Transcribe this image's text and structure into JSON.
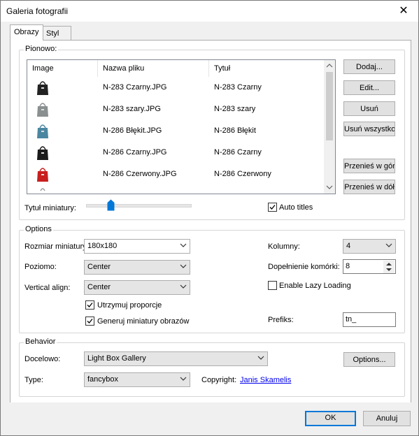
{
  "dialog": {
    "title": "Galeria fotografii",
    "close_symbol": "✕"
  },
  "tabs": [
    {
      "label": "Obrazy",
      "active": true
    },
    {
      "label": "Styl",
      "active": false
    }
  ],
  "pionowo": {
    "legend": "Pionowo:",
    "columns": [
      "Image",
      "Nazwa pliku",
      "Tytuł"
    ],
    "rows": [
      {
        "file": "N-283 Czarny.JPG",
        "title": "N-283 Czarny",
        "color": "#222222"
      },
      {
        "file": "N-283 szary.JPG",
        "title": "N-283 szary",
        "color": "#8a8f8f"
      },
      {
        "file": "N-286 Błękit.JPG",
        "title": "N-286 Błękit",
        "color": "#4b86a0"
      },
      {
        "file": "N-286 Czarny.JPG",
        "title": "N-286 Czarny",
        "color": "#1a1a1a"
      },
      {
        "file": "N-286 Czerwony.JPG",
        "title": "N-286 Czerwony",
        "color": "#c81e1e"
      }
    ],
    "buttons": {
      "add": "Dodaj...",
      "edit": "Edit...",
      "remove": "Usuń",
      "remove_all": "Usuń wszystko",
      "move_up": "Przenieś w górę",
      "move_down": "Przenieś w dół"
    },
    "thumb_title_label": "Tytuł miniatury:",
    "thumb_title_slider_level": 0.2,
    "auto_titles_label": "Auto titles",
    "auto_titles_checked": true
  },
  "options": {
    "legend": "Options",
    "thumb_size_label": "Rozmiar miniatury",
    "thumb_size_value": "180x180",
    "horizontal_label": "Poziomo:",
    "horizontal_value": "Center",
    "vertical_label": "Vertical align:",
    "vertical_value": "Center",
    "keep_proportions_label": "Utrzymuj proporcje",
    "keep_proportions_checked": true,
    "generate_thumbs_label": "Generuj miniatury obrazów",
    "generate_thumbs_checked": true,
    "columns_label": "Kolumny:",
    "columns_value": "4",
    "filled_cells_label": "Dopełnienie komórki:",
    "filled_cells_value": "8",
    "lazy_label": "Enable Lazy Loading",
    "lazy_checked": false,
    "prefix_label": "Prefiks:",
    "prefix_value": "tn_"
  },
  "behavior": {
    "legend": "Behavior",
    "target_label": "Docelowo:",
    "target_value": "Light Box Gallery",
    "options_button": "Options...",
    "type_label": "Type:",
    "type_value": "fancybox",
    "copyright_label": "Copyright:",
    "copyright_link": "Janis Skamelis"
  },
  "footer": {
    "ok": "OK",
    "cancel": "Anuluj"
  }
}
